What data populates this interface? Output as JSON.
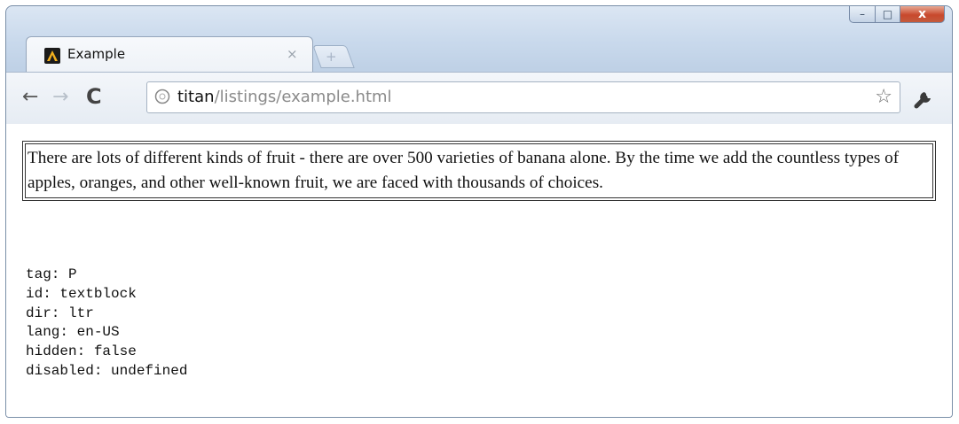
{
  "window": {
    "controls": {
      "minimize": "–",
      "maximize": "□",
      "close": "x"
    }
  },
  "tab": {
    "title": "Example",
    "close_glyph": "×",
    "favicon": "app-logo-icon"
  },
  "new_tab": {
    "glyph": "+"
  },
  "toolbar": {
    "back_glyph": "←",
    "forward_glyph": "→",
    "reload_glyph": "C",
    "url_host": "titan",
    "url_path": "/listings/example.html",
    "bookmark_glyph": "☆"
  },
  "page": {
    "paragraph": "There are lots of different kinds of fruit - there are over 500 varieties of banana alone. By the time we add the countless types of apples, oranges, and other well-known fruit, we are faced with thousands of choices.",
    "properties": [
      "tag: P",
      "id: textblock",
      "dir: ltr",
      "lang: en-US",
      "hidden: false",
      "disabled: undefined"
    ]
  },
  "colors": {
    "frame": "#c9d9ec",
    "close_button": "#c8492d"
  }
}
